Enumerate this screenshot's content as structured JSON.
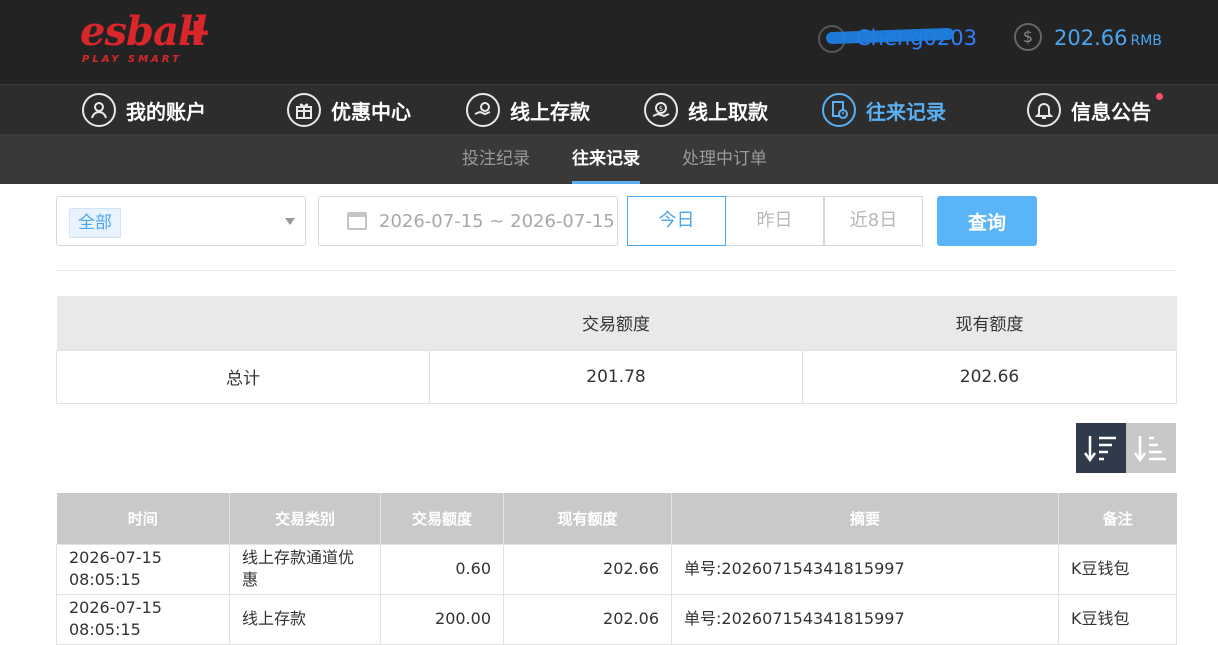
{
  "header": {
    "logo_text": "esball",
    "logo_plus": "+",
    "logo_tagline": "PLAY SMART",
    "username": "Cheng0203",
    "balance": "202.66",
    "balance_unit": "RMB"
  },
  "nav": {
    "items": [
      {
        "label": "我的账户",
        "icon": "user-icon"
      },
      {
        "label": "优惠中心",
        "icon": "gift-icon"
      },
      {
        "label": "线上存款",
        "icon": "deposit-icon"
      },
      {
        "label": "线上取款",
        "icon": "withdraw-icon"
      },
      {
        "label": "往来记录",
        "icon": "records-icon",
        "active": true
      },
      {
        "label": "信息公告",
        "icon": "bell-icon"
      }
    ]
  },
  "subnav": {
    "items": [
      {
        "label": "投注纪录"
      },
      {
        "label": "往来记录",
        "active": true
      },
      {
        "label": "处理中订单"
      }
    ]
  },
  "filter": {
    "type_selected": "全部",
    "date_range": "2026-07-15 ~ 2026-07-15",
    "quick": [
      "今日",
      "昨日",
      "近8日"
    ],
    "quick_active": "今日",
    "search_label": "查询"
  },
  "summary": {
    "headers": [
      "",
      "交易额度",
      "现有额度"
    ],
    "row_label": "总计",
    "transaction_total": "201.78",
    "current_balance": "202.66"
  },
  "records": {
    "headers": [
      "时间",
      "交易类别",
      "交易额度",
      "现有额度",
      "摘要",
      "备注"
    ],
    "rows": [
      {
        "time": "2026-07-15 08:05:15",
        "type": "线上存款通道优惠",
        "amount": "0.60",
        "balance": "202.66",
        "summary": "单号:202607154341815997",
        "note": "K豆钱包"
      },
      {
        "time": "2026-07-15 08:05:15",
        "type": "线上存款",
        "amount": "200.00",
        "balance": "202.06",
        "summary": "单号:202607154341815997",
        "note": "K豆钱包"
      }
    ]
  },
  "colors": {
    "accent": "#4aa6f0",
    "brand_red": "#d8262b",
    "header_bg": "#232323",
    "active_sort_bg": "#2f3a4b"
  }
}
